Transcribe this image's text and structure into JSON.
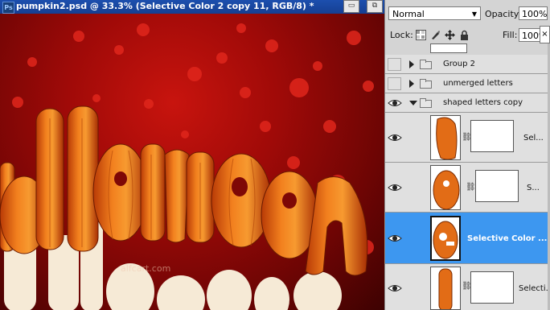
{
  "document": {
    "title": "pumpkin2.psd @ 33.3% (Selective Color 2 copy 11, RGB/8) *",
    "app_badge": "Ps",
    "watermark": "alfcart.com",
    "close_glyph": "×"
  },
  "window_controls": {
    "minimize": "▭",
    "restore": "⧉"
  },
  "layers_panel": {
    "blend_mode": "Normal",
    "opacity_label": "Opacity:",
    "opacity_value": "100%",
    "lock_label": "Lock:",
    "fill_label": "Fill:",
    "fill_value": "100%",
    "groups": [
      {
        "name": "Group 2",
        "visible": false,
        "expanded": false
      },
      {
        "name": "unmerged letters",
        "visible": false,
        "expanded": false
      },
      {
        "name": "shaped letters copy",
        "visible": true,
        "expanded": true
      }
    ],
    "layers": [
      {
        "name": "Sel...",
        "visible": true,
        "active": false
      },
      {
        "name": "S...",
        "visible": true,
        "active": false
      },
      {
        "name": "Selective Color ...",
        "visible": true,
        "active": true
      },
      {
        "name": "Selecti...",
        "visible": true,
        "active": false
      }
    ]
  },
  "colors": {
    "title_bar": "#1c4fae",
    "active_layer": "#3d97f0",
    "panel_bg": "#d4d4d4"
  }
}
